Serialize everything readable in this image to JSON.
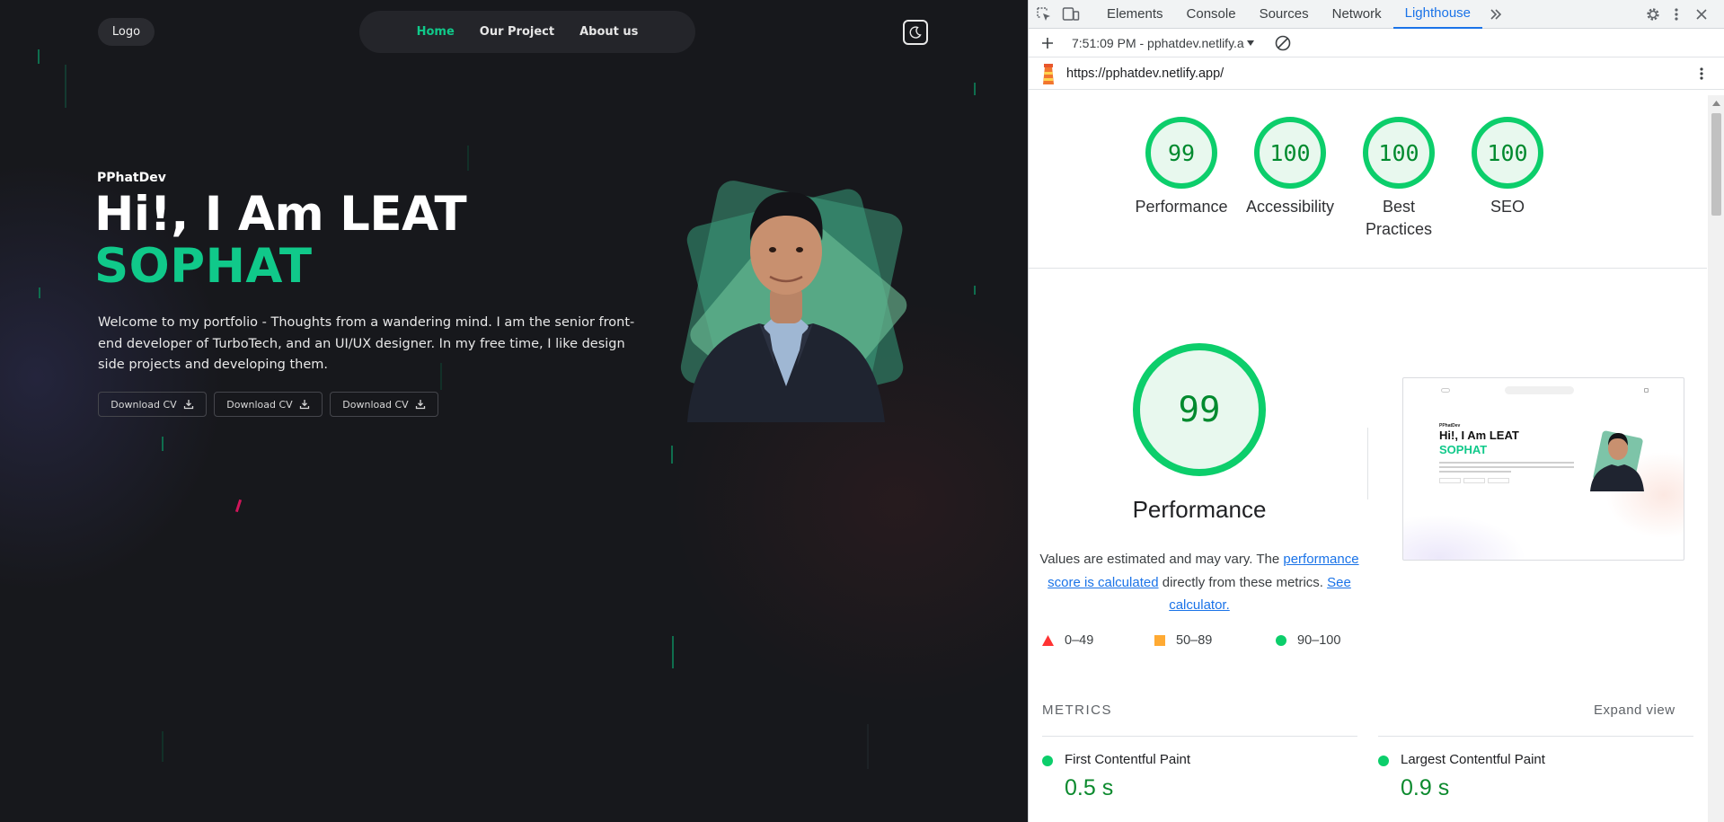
{
  "site": {
    "logo": "Logo",
    "nav": [
      "Home",
      "Our Project",
      "About us"
    ],
    "hero_small": "PPhatDev",
    "hero_line1": "Hi!, I Am LEAT",
    "hero_line2": "SOPHAT",
    "description": "Welcome to my portfolio - Thoughts from a wandering mind. I am the senior front-end developer of TurboTech, and an UI/UX designer. In my free time, I like design side projects and developing them.",
    "cv_buttons": [
      "Download CV",
      "Download CV",
      "Download CV"
    ],
    "accent_color": "#10c98a"
  },
  "devtools": {
    "tabs": [
      "Elements",
      "Console",
      "Sources",
      "Network",
      "Lighthouse"
    ],
    "active_tab": "Lighthouse",
    "report_label": "7:51:09 PM - pphatdev.netlify.a",
    "url": "https://pphatdev.netlify.app/",
    "scores": [
      {
        "value": "99",
        "label": "Performance"
      },
      {
        "value": "100",
        "label": "Accessibility"
      },
      {
        "value": "100",
        "label": "Best Practices"
      },
      {
        "value": "100",
        "label": "SEO"
      }
    ],
    "performance": {
      "score": "99",
      "title": "Performance",
      "desc_prefix": "Values are estimated and may vary. The",
      "desc_link1": "performance score is calculated",
      "desc_middle": "directly from these metrics.",
      "desc_link2": "See calculator."
    },
    "legend": [
      {
        "range": "0–49",
        "color": "#ff3333",
        "shape": "triangle"
      },
      {
        "range": "50–89",
        "color": "#ffaa33",
        "shape": "square"
      },
      {
        "range": "90–100",
        "color": "#0cce6b",
        "shape": "circle"
      }
    ],
    "metrics_heading": "METRICS",
    "expand_label": "Expand view",
    "metrics": [
      {
        "name": "First Contentful Paint",
        "value": "0.5 s"
      },
      {
        "name": "Largest Contentful Paint",
        "value": "0.9 s"
      }
    ],
    "thumbnail": {
      "hero_small": "PPhatDev",
      "line1": "Hi!, I Am LEAT",
      "line2": "SOPHAT"
    }
  }
}
